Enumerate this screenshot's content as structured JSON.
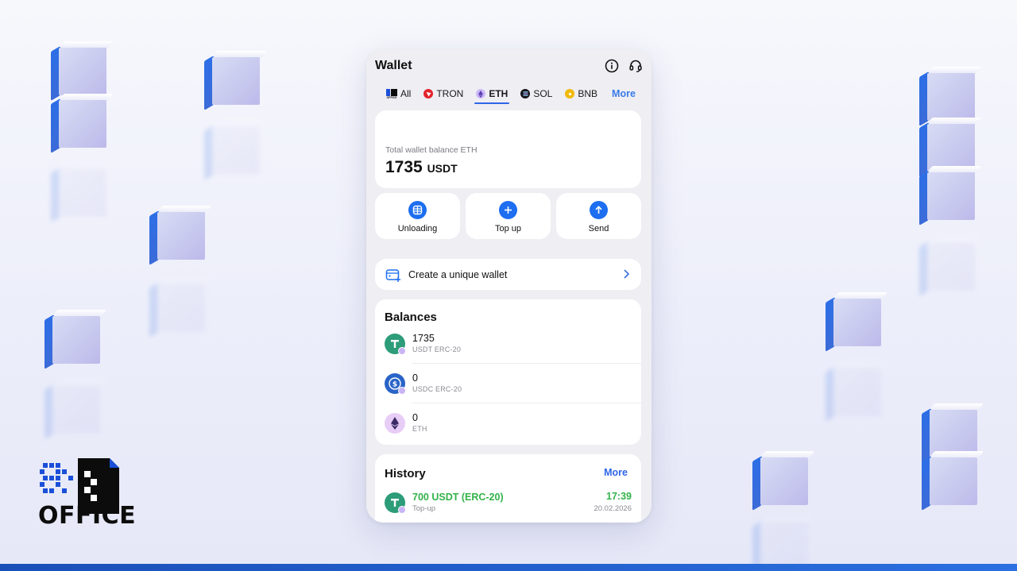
{
  "brand": {
    "logo_text": "OFFICE",
    "tab_logo_text": "OFFICE"
  },
  "wallet": {
    "title": "Wallet",
    "header_icons": [
      "info-icon",
      "headset-support-icon"
    ],
    "tabs": [
      {
        "label": "All",
        "icon": "office-logo-icon",
        "active": false
      },
      {
        "label": "TRON",
        "icon": "tron-icon",
        "color": "#e3232b",
        "active": false
      },
      {
        "label": "ETH",
        "icon": "eth-icon",
        "color": "#b39af0",
        "active": true
      },
      {
        "label": "SOL",
        "icon": "sol-icon",
        "color": "#14141a",
        "active": false
      },
      {
        "label": "BNB",
        "icon": "bnb-icon",
        "color": "#f0b90b",
        "active": false
      }
    ],
    "tabs_more": "More",
    "balance": {
      "label": "Total wallet balance ETH",
      "value": "1735",
      "unit": "USDT"
    },
    "actions": [
      {
        "label": "Unloading",
        "icon": "unloading-icon"
      },
      {
        "label": "Top up",
        "icon": "plus-icon"
      },
      {
        "label": "Send",
        "icon": "arrow-up-icon"
      }
    ],
    "create_wallet": {
      "label": "Create a unique wallet"
    },
    "balances": {
      "title": "Balances",
      "items": [
        {
          "amount": "1735",
          "token": "USDT ERC-20",
          "icon": "usdt-icon",
          "color": "#2d9c78"
        },
        {
          "amount": "0",
          "token": "USDC ERC-20",
          "icon": "usdc-icon",
          "color": "#2a64c8"
        },
        {
          "amount": "0",
          "token": "ETH",
          "icon": "eth-icon",
          "color": "#e8cdf6"
        }
      ]
    },
    "history": {
      "title": "History",
      "more": "More",
      "items": [
        {
          "amount": "700 USDT (ERC-20)",
          "type": "Top-up",
          "time": "17:39",
          "date": "20.02.2026"
        }
      ]
    }
  },
  "colors": {
    "accent": "#1d6ef0",
    "success": "#33b24a",
    "bar": "#1a4fb8"
  }
}
